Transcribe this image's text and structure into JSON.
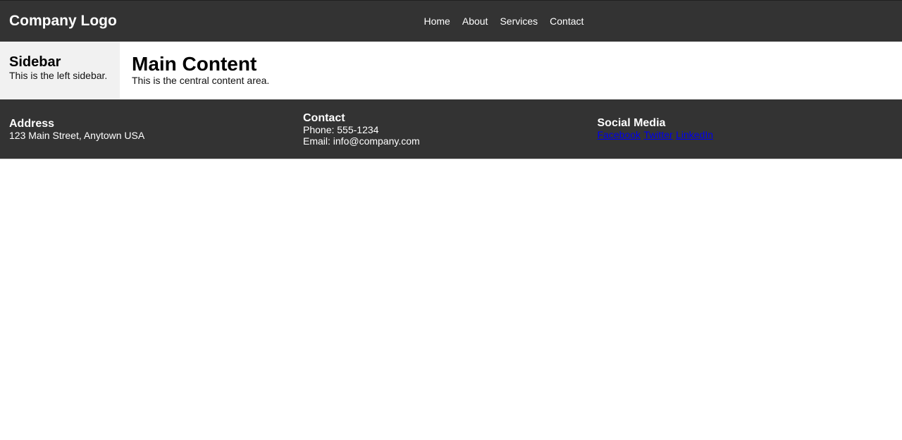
{
  "header": {
    "logo": "Company Logo",
    "nav": [
      "Home",
      "About",
      "Services",
      "Contact"
    ]
  },
  "sidebar": {
    "title": "Sidebar",
    "text": "This is the left sidebar."
  },
  "main": {
    "title": "Main Content",
    "text": "This is the central content area."
  },
  "footer": {
    "address": {
      "title": "Address",
      "line": "123 Main Street, Anytown USA"
    },
    "contact": {
      "title": "Contact",
      "phone": "Phone: 555-1234",
      "email": "Email: info@company.com"
    },
    "social": {
      "title": "Social Media",
      "links": [
        "Facebook",
        "Twitter",
        "LinkedIn"
      ]
    }
  },
  "colors": {
    "bar_bg": "#333333",
    "sidebar_bg": "#f1f1f1",
    "link": "#0000ee"
  }
}
